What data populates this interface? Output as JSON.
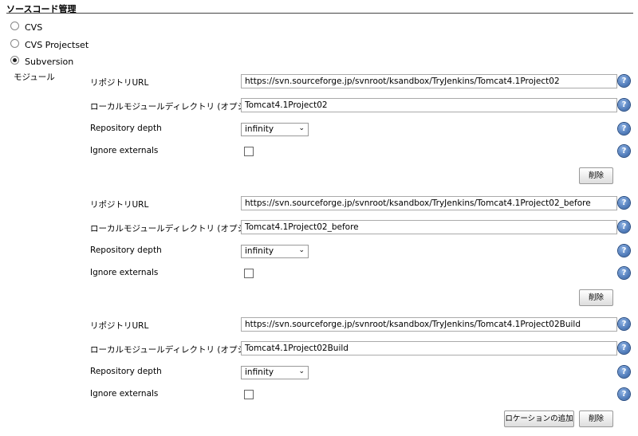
{
  "section_title": "ソースコード管理",
  "scm_options": [
    {
      "label": "CVS",
      "selected": false
    },
    {
      "label": "CVS Projectset",
      "selected": false
    },
    {
      "label": "Subversion",
      "selected": true
    }
  ],
  "modules_label": "モジュール",
  "labels": {
    "repo_url": "リポジトリURL",
    "local_dir": "ローカルモジュールディレクトリ (オプション)",
    "depth": "Repository depth",
    "ignore": "Ignore externals",
    "delete": "削除",
    "add_location": "ロケーションの追加",
    "help": "?"
  },
  "modules": [
    {
      "repo_url": "https://svn.sourceforge.jp/svnroot/ksandbox/TryJenkins/Tomcat4.1Project02",
      "local_dir": "Tomcat4.1Project02",
      "depth": "infinity",
      "ignore_externals": false
    },
    {
      "repo_url": "https://svn.sourceforge.jp/svnroot/ksandbox/TryJenkins/Tomcat4.1Project02_before",
      "local_dir": "Tomcat4.1Project02_before",
      "depth": "infinity",
      "ignore_externals": false
    },
    {
      "repo_url": "https://svn.sourceforge.jp/svnroot/ksandbox/TryJenkins/Tomcat4.1Project02Build",
      "local_dir": "Tomcat4.1Project02Build",
      "depth": "infinity",
      "ignore_externals": false
    }
  ]
}
